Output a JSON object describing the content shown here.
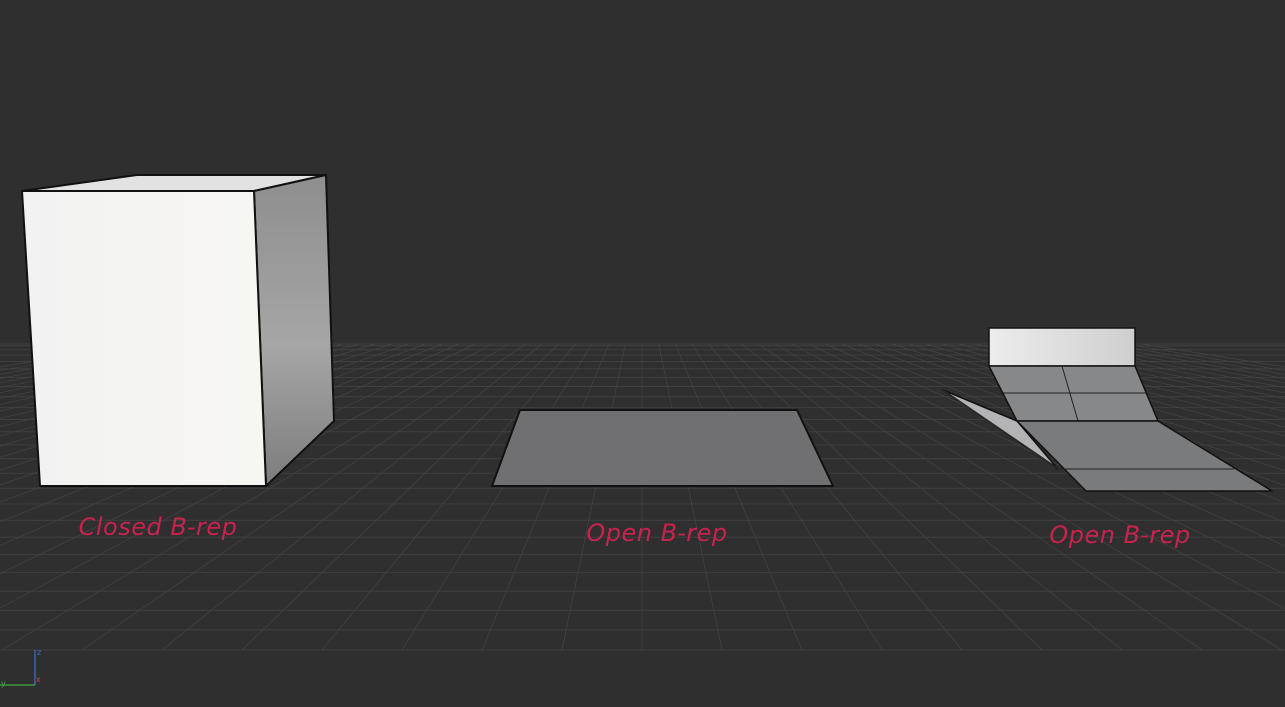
{
  "viewport": {
    "background": "#2f2f2f",
    "grid_line_color": "#444444",
    "label_color": "#c8234f"
  },
  "objects": [
    {
      "name": "closed-box",
      "caption": "Closed B-rep",
      "kind": "closed"
    },
    {
      "name": "flat-plane",
      "caption": "Open B-rep",
      "kind": "open"
    },
    {
      "name": "folded-surface",
      "caption": "Open B-rep",
      "kind": "open"
    }
  ],
  "axis_gizmo": {
    "x_label": "x",
    "y_label": "y",
    "z_label": "z",
    "x_color": "#d04040",
    "y_color": "#3fae3f",
    "z_color": "#4070d0"
  }
}
